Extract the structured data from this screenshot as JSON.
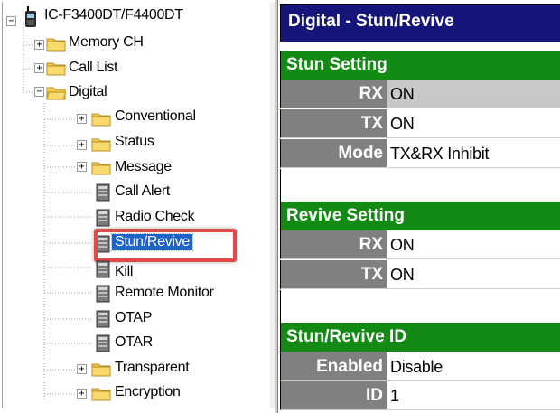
{
  "tree": {
    "root_label": "IC-F3400DT/F4400DT",
    "items": [
      {
        "label": "Memory CH",
        "type": "folder"
      },
      {
        "label": "Call List",
        "type": "folder"
      },
      {
        "label": "Digital",
        "type": "folder-open"
      },
      {
        "label": "Conventional",
        "type": "folder"
      },
      {
        "label": "Status",
        "type": "folder"
      },
      {
        "label": "Message",
        "type": "folder"
      },
      {
        "label": "Call Alert",
        "type": "leaf"
      },
      {
        "label": "Radio Check",
        "type": "leaf"
      },
      {
        "label": "Stun/Revive",
        "type": "leaf",
        "selected": true
      },
      {
        "label": "Kill",
        "type": "leaf"
      },
      {
        "label": "Remote Monitor",
        "type": "leaf"
      },
      {
        "label": "OTAP",
        "type": "leaf"
      },
      {
        "label": "OTAR",
        "type": "leaf"
      },
      {
        "label": "Transparent",
        "type": "folder"
      },
      {
        "label": "Encryption",
        "type": "folder"
      }
    ],
    "expand_symbol": "+",
    "collapse_symbol": "−"
  },
  "panel": {
    "title": "Digital - Stun/Revive",
    "sections": [
      {
        "header": "Stun Setting",
        "rows": [
          {
            "name": "RX",
            "value": "ON"
          },
          {
            "name": "TX",
            "value": "ON"
          },
          {
            "name": "Mode",
            "value": "TX&RX Inhibit"
          }
        ]
      },
      {
        "header": "Revive Setting",
        "rows": [
          {
            "name": "RX",
            "value": "ON"
          },
          {
            "name": "TX",
            "value": "ON"
          }
        ]
      },
      {
        "header": "Stun/Revive ID",
        "rows": [
          {
            "name": "Enabled",
            "value": "Disable"
          },
          {
            "name": "ID",
            "value": "1"
          }
        ]
      }
    ]
  },
  "colors": {
    "title_bg": "#16167a",
    "section_bg": "#138a13",
    "name_bg": "#808080",
    "selection_bg": "#1e63c9",
    "highlight_border": "#e24a4a",
    "folder_yellow": "#f2c94c"
  }
}
